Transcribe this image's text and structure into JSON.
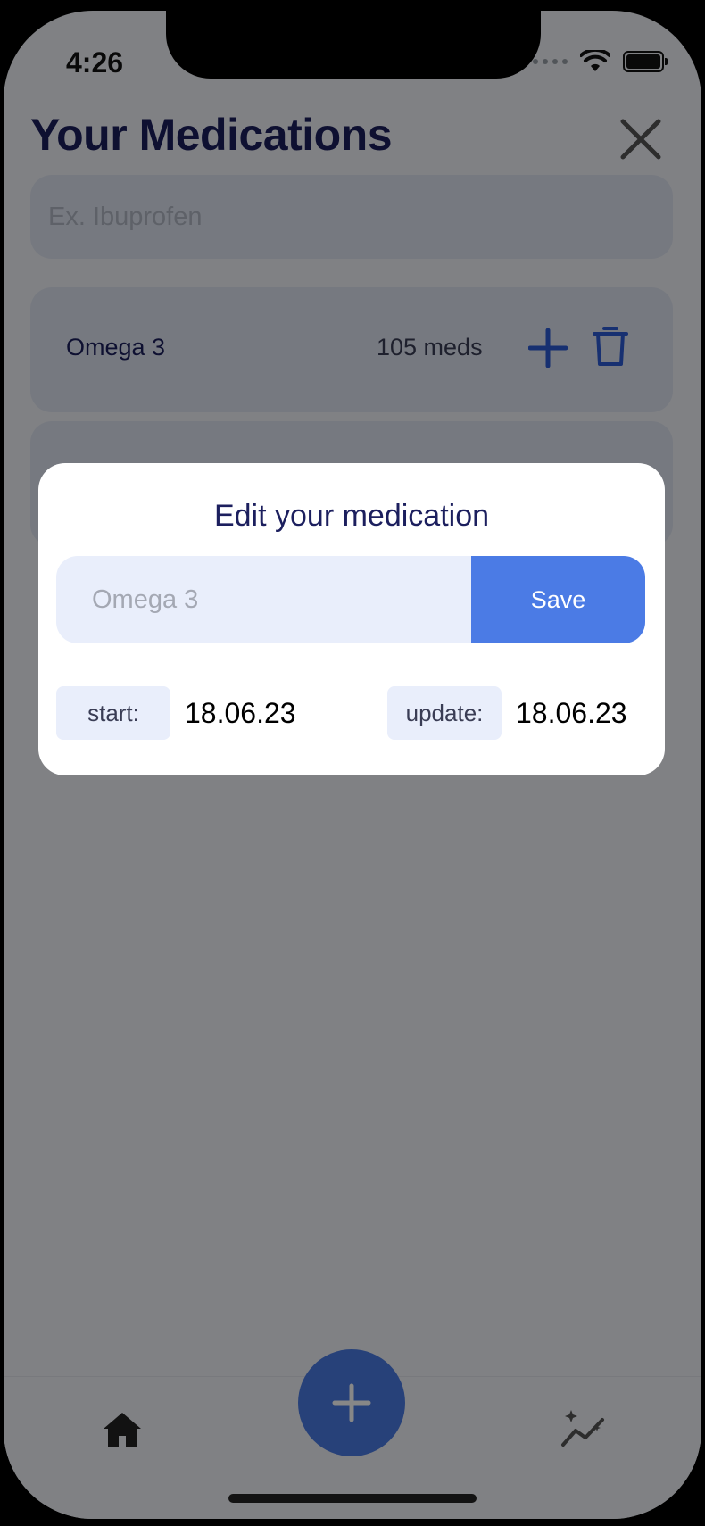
{
  "status_bar": {
    "time": "4:26"
  },
  "header": {
    "title": "Your Medications"
  },
  "search": {
    "placeholder": "Ex. Ibuprofen"
  },
  "medications": [
    {
      "name": "Omega 3",
      "count": "105 meds"
    }
  ],
  "modal": {
    "title": "Edit your medication",
    "name_value": "Omega 3",
    "save_label": "Save",
    "start_label": "start:",
    "start_value": "18.06.23",
    "update_label": "update:",
    "update_value": "18.06.23"
  },
  "icons": {
    "close": "close-icon",
    "add_dose": "plus-icon",
    "delete": "trash-icon",
    "home": "home-icon",
    "stats": "chart-sparkle-icon",
    "fab": "plus-icon"
  },
  "colors": {
    "primary": "#4b7be5",
    "title": "#1c1f5e",
    "card": "#dfe5f2",
    "input": "#e9eefb"
  }
}
